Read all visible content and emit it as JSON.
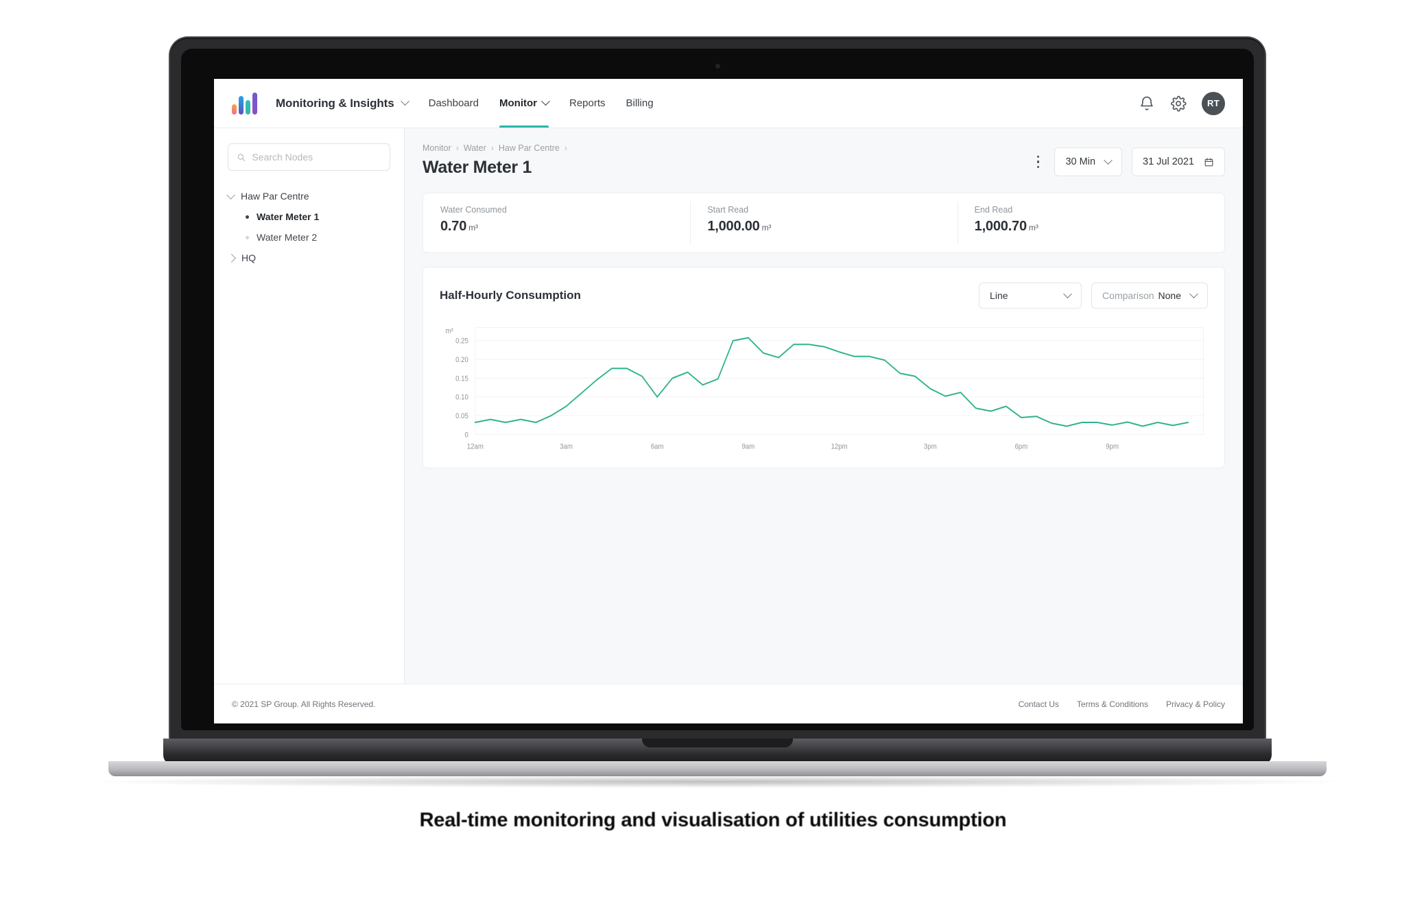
{
  "header": {
    "brand": "Monitoring & Insights",
    "logo_icon": "bar-chart-logo",
    "brand_chevron_icon": "chevron-down-icon",
    "nav": [
      {
        "label": "Dashboard",
        "active": false,
        "has_chevron": false
      },
      {
        "label": "Monitor",
        "active": true,
        "has_chevron": true
      },
      {
        "label": "Reports",
        "active": false,
        "has_chevron": false
      },
      {
        "label": "Billing",
        "active": false,
        "has_chevron": false
      }
    ],
    "notification_icon": "bell-icon",
    "settings_icon": "gear-icon",
    "avatar_initials": "RT",
    "accent_color": "#2ab5a6"
  },
  "sidebar": {
    "search_placeholder": "Search Nodes",
    "search_value": "",
    "search_icon": "search-icon",
    "tree": {
      "group_label": "Haw Par Centre",
      "group_expanded_icon": "chevron-down-icon",
      "children": [
        {
          "label": "Water Meter 1",
          "selected": true
        },
        {
          "label": "Water Meter 2",
          "selected": false
        }
      ],
      "second_group_label": "HQ",
      "second_group_collapsed_icon": "chevron-right-icon"
    }
  },
  "main": {
    "breadcrumb": [
      "Monitor",
      "Water",
      "Haw Par Centre"
    ],
    "breadcrumb_separator": "›",
    "page_title": "Water Meter 1",
    "kebab_icon": "more-vertical-icon",
    "interval_select": {
      "value": "30 Min",
      "icon": "chevron-down-icon"
    },
    "date_select": {
      "value": "31 Jul 2021",
      "icon": "calendar-icon"
    },
    "stats": [
      {
        "label": "Water Consumed",
        "value": "0.70",
        "unit": "m³"
      },
      {
        "label": "Start Read",
        "value": "1,000.00",
        "unit": "m³"
      },
      {
        "label": "End Read",
        "value": "1,000.70",
        "unit": "m³"
      }
    ],
    "chart_panel": {
      "title": "Half-Hourly Consumption",
      "chart_type_select": {
        "value": "Line",
        "icon": "chevron-down-icon"
      },
      "comparison_select": {
        "label": "Comparison",
        "value": "None",
        "icon": "chevron-down-icon"
      }
    }
  },
  "chart_data": {
    "type": "line",
    "title": "Half-Hourly Consumption",
    "xlabel": "",
    "ylabel": "m³",
    "unit": "m³",
    "line_color": "#2eb38f",
    "grid": true,
    "legend": null,
    "ylim": [
      0,
      0.285
    ],
    "ytick_labels": [
      "0.25",
      "0.20",
      "0.15",
      "0.10",
      "0.05",
      "0"
    ],
    "ytick_values": [
      0.25,
      0.2,
      0.15,
      0.1,
      0.05,
      0
    ],
    "xtick_labels": [
      "12am",
      "3am",
      "6am",
      "9am",
      "12pm",
      "3pm",
      "6pm",
      "9pm"
    ],
    "xtick_positions_hours": [
      0,
      3,
      6,
      9,
      12,
      15,
      18,
      21
    ],
    "x_hours": [
      0,
      0.5,
      1,
      1.5,
      2,
      2.5,
      3,
      3.5,
      4,
      4.5,
      5,
      5.5,
      6,
      6.5,
      7,
      7.5,
      8,
      8.5,
      9,
      9.5,
      10,
      10.5,
      11,
      11.5,
      12,
      12.5,
      13,
      13.5,
      14,
      14.5,
      15,
      15.5,
      16,
      16.5,
      17,
      17.5,
      18,
      18.5,
      19,
      19.5,
      20,
      20.5,
      21,
      21.5,
      22,
      22.5,
      23,
      23.5
    ],
    "values": [
      0.032,
      0.04,
      0.032,
      0.04,
      0.032,
      0.05,
      0.075,
      0.11,
      0.145,
      0.176,
      0.176,
      0.155,
      0.1,
      0.15,
      0.166,
      0.132,
      0.148,
      0.25,
      0.258,
      0.217,
      0.205,
      0.24,
      0.24,
      0.234,
      0.22,
      0.208,
      0.208,
      0.198,
      0.163,
      0.155,
      0.122,
      0.102,
      0.112,
      0.07,
      0.062,
      0.075,
      0.045,
      0.048,
      0.03,
      0.022,
      0.032,
      0.032,
      0.025,
      0.033,
      0.022,
      0.032,
      0.024,
      0.032
    ]
  },
  "footer": {
    "copyright": "© 2021 SP Group. All Rights Reserved.",
    "links": [
      "Contact Us",
      "Terms & Conditions",
      "Privacy & Policy"
    ]
  },
  "caption": "Real-time monitoring and visualisation of utilities consumption"
}
